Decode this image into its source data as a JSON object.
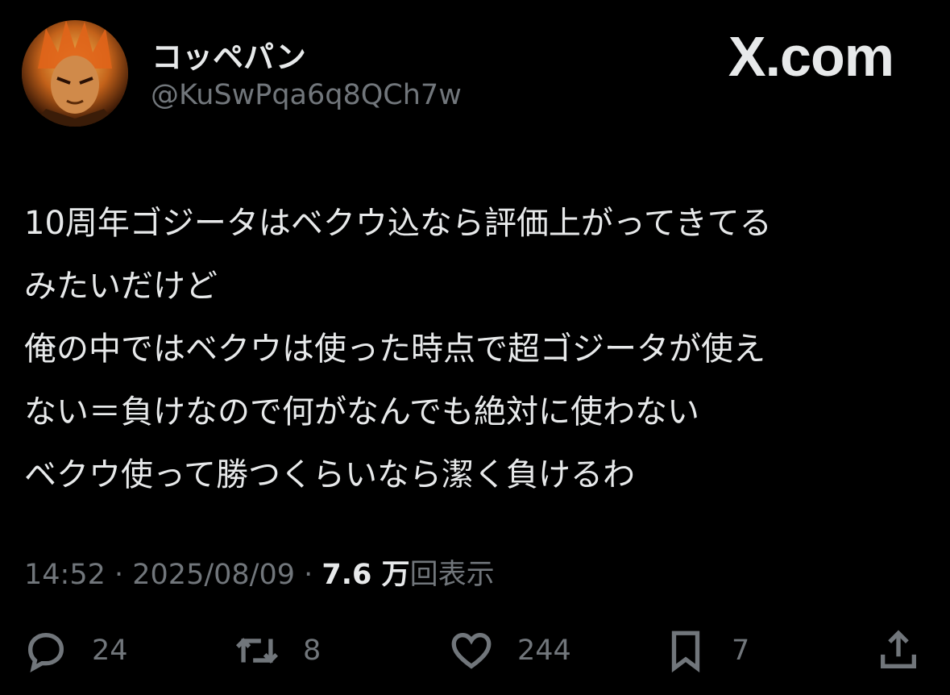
{
  "user": {
    "display_name": "コッペパン",
    "handle": "@KuSwPqa6q8QCh7w",
    "avatar_icon": "avatar-image"
  },
  "brand": {
    "label": "X.com"
  },
  "tweet": {
    "lines": [
      "10周年ゴジータはベクウ込なら評価上がってきてる",
      "みたいだけど",
      "俺の中ではベクウは使った時点で超ゴジータが使え",
      "ない＝負けなので何がなんでも絶対に使わない",
      "ベクウ使って勝つくらいなら潔く負けるわ"
    ]
  },
  "meta": {
    "time": "14:52",
    "date": "2025/08/09",
    "views_count": "7.6 万",
    "views_label": "回表示"
  },
  "actions": {
    "reply": {
      "icon": "reply-icon",
      "count": "24"
    },
    "repost": {
      "icon": "repost-icon",
      "count": "8"
    },
    "like": {
      "icon": "heart-icon",
      "count": "244"
    },
    "bookmark": {
      "icon": "bookmark-icon",
      "count": "7"
    },
    "share": {
      "icon": "share-icon"
    }
  },
  "colors": {
    "background": "#000000",
    "primary_text": "#e7e9ea",
    "secondary_text": "#71767b"
  }
}
